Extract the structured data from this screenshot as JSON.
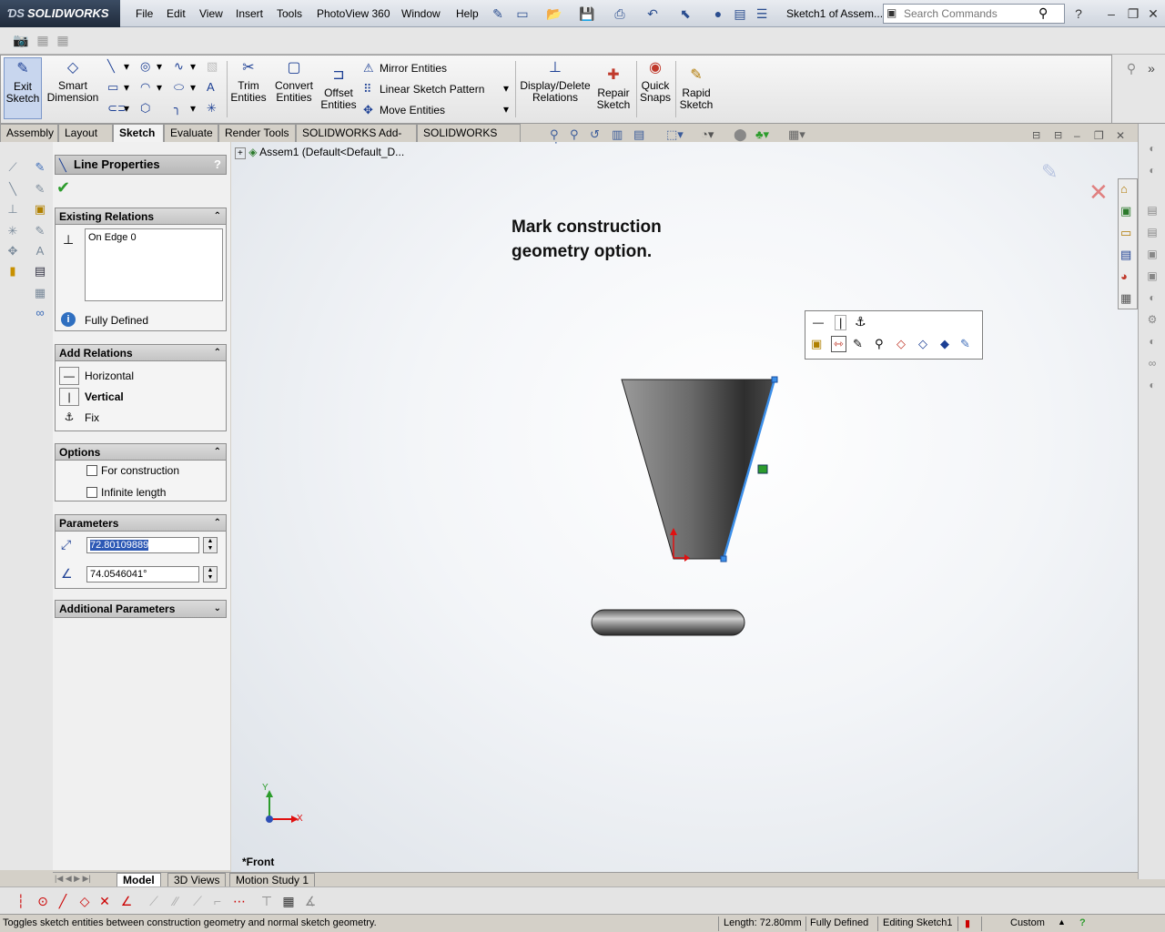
{
  "app": {
    "brand": "SOLIDWORKS",
    "document_title": "Sketch1 of Assem...",
    "search_placeholder": "Search Commands"
  },
  "menu": [
    "File",
    "Edit",
    "View",
    "Insert",
    "Tools",
    "PhotoView 360",
    "Window",
    "Help"
  ],
  "command_manager": {
    "exit_sketch": "Exit\nSketch",
    "smart_dimension": "Smart\nDimension",
    "trim_entities": "Trim\nEntities",
    "convert_entities": "Convert\nEntities",
    "offset_entities": "Offset\nEntities",
    "mirror_entities": "Mirror Entities",
    "linear_sketch_pattern": "Linear Sketch Pattern",
    "move_entities": "Move Entities",
    "display_delete_relations": "Display/Delete\nRelations",
    "repair_sketch": "Repair\nSketch",
    "quick_snaps": "Quick\nSnaps",
    "rapid_sketch": "Rapid\nSketch"
  },
  "tabs": [
    "Assembly",
    "Layout",
    "Sketch",
    "Evaluate",
    "Render Tools",
    "SOLIDWORKS Add-Ins",
    "SOLIDWORKS MBD"
  ],
  "active_tab": "Sketch",
  "property_manager": {
    "title": "Line Properties",
    "help": "?",
    "existing_relations": {
      "header": "Existing Relations",
      "items": [
        "On Edge 0"
      ],
      "status": "Fully Defined"
    },
    "add_relations": {
      "header": "Add Relations",
      "items": [
        "Horizontal",
        "Vertical",
        "Fix"
      ]
    },
    "options": {
      "header": "Options",
      "for_construction": "For construction",
      "infinite_length": "Infinite length"
    },
    "parameters": {
      "header": "Parameters",
      "length": "72.80109889",
      "angle": "74.0546041°"
    },
    "additional_parameters": "Additional Parameters"
  },
  "viewport": {
    "tree_root": "Assem1  (Default<Default_D...",
    "annotation_line1": "Mark construction",
    "annotation_line2": "geometry option.",
    "view_name": "*Front",
    "axis_x": "X",
    "axis_y": "Y"
  },
  "bottom_tabs": [
    "Model",
    "3D Views",
    "Motion Study 1"
  ],
  "active_bottom_tab": "Model",
  "status_bar": {
    "message": "Toggles sketch entities between construction geometry and normal sketch geometry.",
    "length": "Length: 72.80mm",
    "state": "Fully Defined",
    "editing": "Editing Sketch1",
    "units": "Custom"
  },
  "colors": {
    "selection_blue": "#3b8ee8",
    "origin_red": "#e01010",
    "accent_blue": "#1c3f94"
  }
}
